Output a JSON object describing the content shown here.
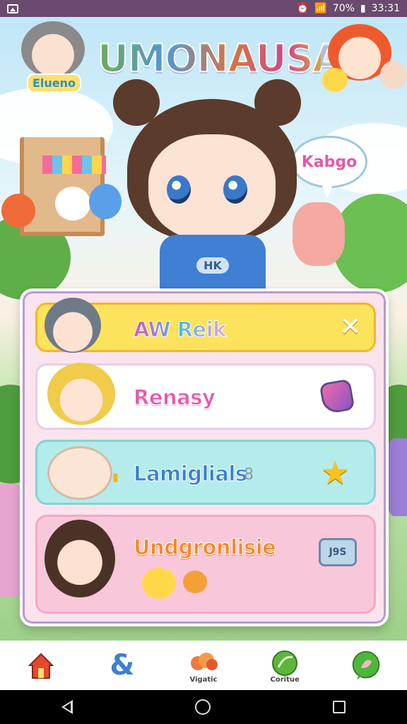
{
  "status_bar": {
    "battery_text": "70%",
    "time": "33:31"
  },
  "game": {
    "title": "UMONAUSA",
    "player_tag": "Elueno",
    "speech_bubble": "Kabgo",
    "hero_shirt_text": "HK"
  },
  "menu": {
    "items": [
      {
        "label": "AW Reik",
        "action_icon": "close-icon"
      },
      {
        "label": "Renasy",
        "action_icon": "heart-gem-icon"
      },
      {
        "label": "Lamiglials",
        "extra": "8",
        "action_icon": "star-icon"
      },
      {
        "label": "Undgronlisie",
        "badge": "J9S",
        "action_icon": "badge-icon"
      }
    ]
  },
  "nav": {
    "items": [
      {
        "label": "",
        "icon": "house-icon",
        "color": "#e5482f"
      },
      {
        "label": "",
        "icon": "ampersand-icon",
        "color": "#3d7fd1"
      },
      {
        "label": "Vigatic",
        "icon": "flower-icon",
        "color": "#f07a3a"
      },
      {
        "label": "Coritue",
        "icon": "leaf-icon",
        "color": "#5cb63a"
      },
      {
        "label": "",
        "icon": "chat-icon",
        "color": "#4cb83a"
      }
    ]
  },
  "colors": {
    "row1": "#fde35c",
    "row2": "#ffffff",
    "row3": "#b4ecec",
    "row4": "#f9c7da",
    "panel": "#fbe3ee"
  }
}
